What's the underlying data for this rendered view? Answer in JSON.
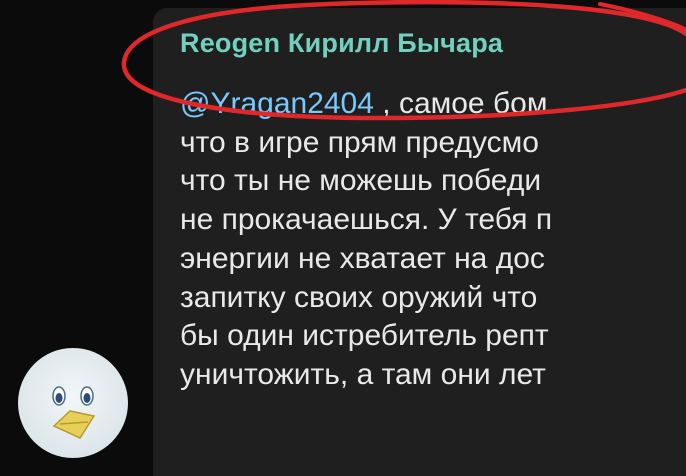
{
  "message": {
    "sender_name": "Reogen Кирилл Бычара",
    "mention": "@Yragan2404",
    "lines": [
      " , самое бом",
      "что в игре прям предусмо",
      "что ты не можешь победи",
      "не прокачаешься. У тебя п",
      "энергии не хватает на дос",
      "запитку своих оружий что",
      "бы один истребитель репт",
      "уничтожить, а там они лет"
    ]
  },
  "avatar": {
    "icon": "penguin-avatar-icon"
  },
  "annotation": {
    "icon": "red-circle-highlight",
    "color": "#e0282b"
  },
  "colors": {
    "background": "#0b0b0b",
    "bubble": "#1f1f1f",
    "sender": "#72d0c0",
    "mention": "#79c9ff",
    "text": "#e9e9e9"
  }
}
